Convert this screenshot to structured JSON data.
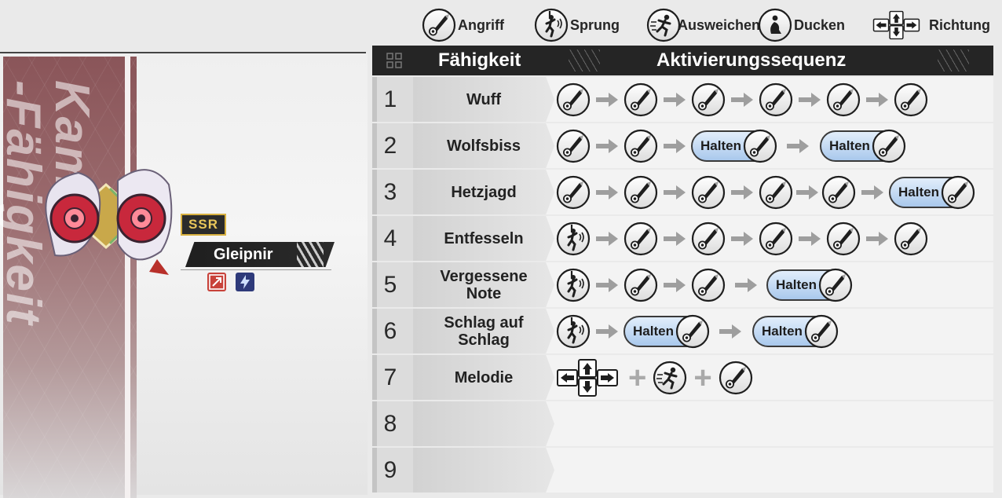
{
  "legend": {
    "attack": {
      "label": "Angriff",
      "icon": "sword-icon"
    },
    "jump": {
      "label": "Sprung",
      "icon": "jump-icon"
    },
    "dodge": {
      "label": "Ausweichen",
      "icon": "dodge-icon"
    },
    "crouch": {
      "label": "Ducken",
      "icon": "crouch-icon"
    },
    "direction": {
      "label": "Richtung",
      "icon": "dpad-icon"
    }
  },
  "character": {
    "banner_text": "Kam\n-Fähigkeit",
    "rarity": "SSR",
    "name": "Gleipnir",
    "tags": [
      "attack-type-icon",
      "lightning-icon"
    ]
  },
  "table": {
    "col_skill": "Fähigkeit",
    "col_sequence": "Aktivierungssequenz",
    "hold_label": "Halten",
    "rows": [
      {
        "num": "1",
        "name": "Wuff"
      },
      {
        "num": "2",
        "name": "Wolfsbiss"
      },
      {
        "num": "3",
        "name": "Hetzjagd"
      },
      {
        "num": "4",
        "name": "Entfesseln"
      },
      {
        "num": "5",
        "name": "Vergessene\nNote"
      },
      {
        "num": "6",
        "name": "Schlag auf\nSchlag"
      },
      {
        "num": "7",
        "name": "Melodie"
      },
      {
        "num": "8",
        "name": ""
      },
      {
        "num": "9",
        "name": ""
      }
    ]
  },
  "colors": {
    "header_bg": "#252525",
    "hold_blue": "#a9c8ec",
    "banner": "#8a5559",
    "ssr_gold": "#d7b040"
  }
}
